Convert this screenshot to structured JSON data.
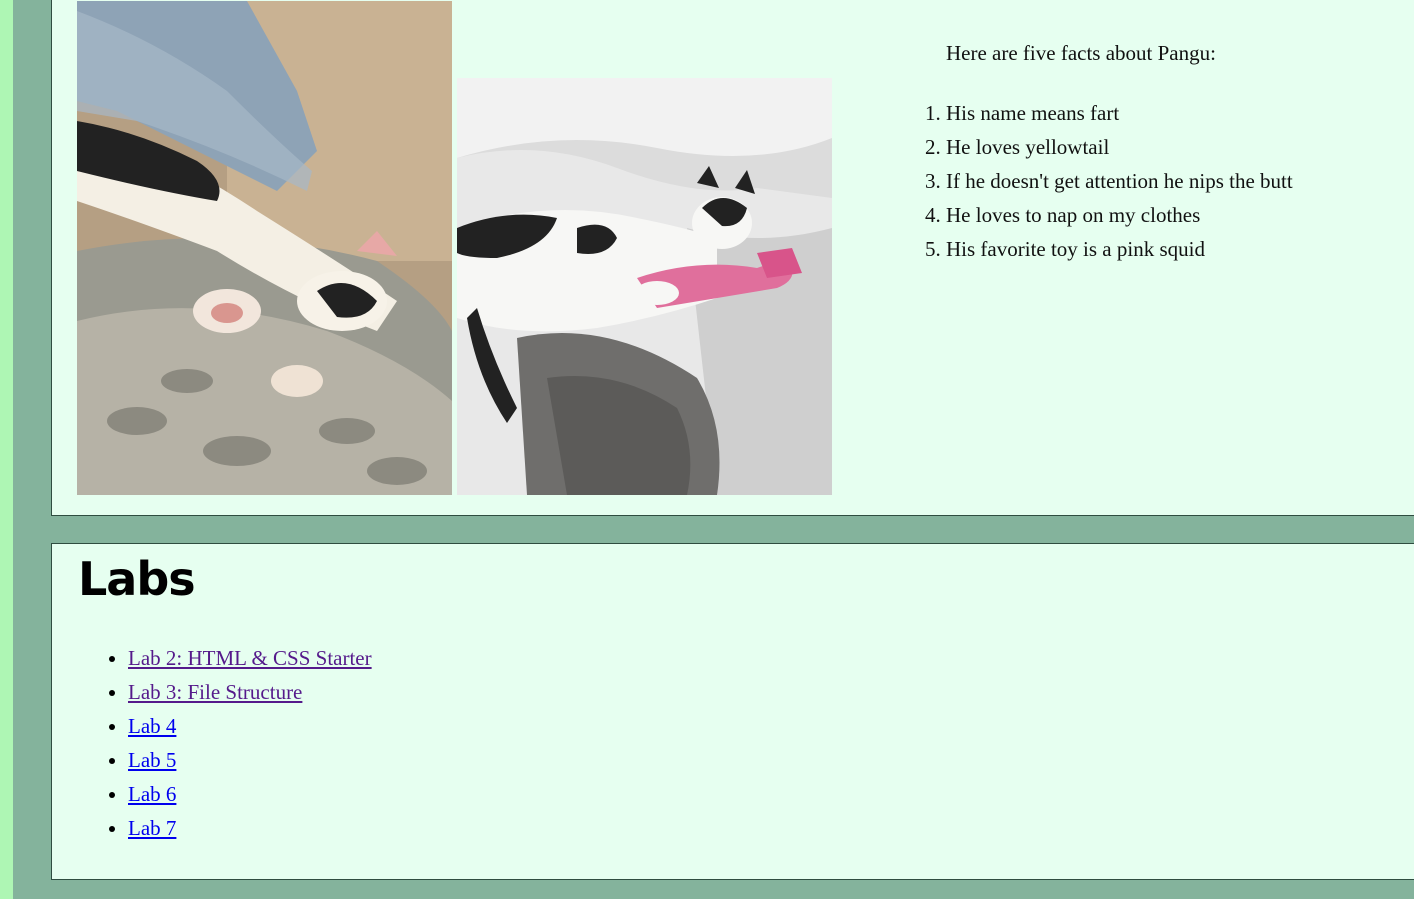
{
  "colors": {
    "page_bg": "#84b39c",
    "left_strip": "#aef6b4",
    "panel_bg": "#e6fff0",
    "link": "#0000ee",
    "visited_link": "#551a8b"
  },
  "facts": {
    "intro": "Here are five facts about Pangu:",
    "items": [
      "His name means fart",
      "He loves yellowtail",
      "If he doesn't get attention he nips the butt",
      "He loves to nap on my clothes",
      "His favorite toy is a pink squid"
    ]
  },
  "labs": {
    "title": "Labs",
    "links": [
      {
        "label": "Lab 2: HTML & CSS Starter",
        "visited": true
      },
      {
        "label": "Lab 3: File Structure",
        "visited": true
      },
      {
        "label": "Lab 4",
        "visited": false
      },
      {
        "label": "Lab 5",
        "visited": false
      },
      {
        "label": "Lab 6",
        "visited": false
      },
      {
        "label": "Lab 7",
        "visited": false
      }
    ]
  }
}
